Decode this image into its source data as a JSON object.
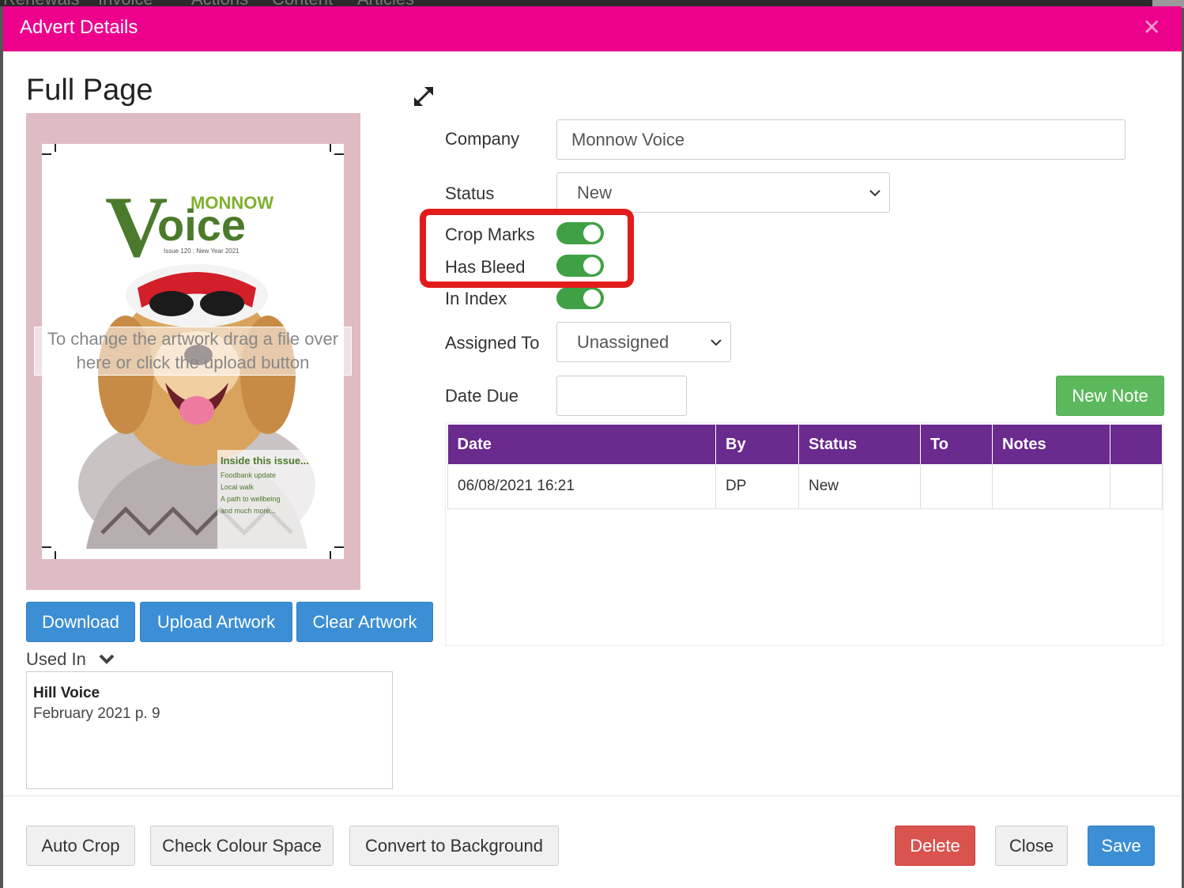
{
  "background": {
    "nav_items": [
      "Renewals",
      "Invoice",
      "Actions",
      "Content",
      "Articles"
    ]
  },
  "modal": {
    "title": "Advert Details",
    "close_icon": "close-icon",
    "heading": "Full Page",
    "expand_icon": "expand-arrows-icon"
  },
  "artwork": {
    "drop_hint": "To change the artwork drag a file over here or click the upload button",
    "cover": {
      "masthead_small": "MONNOW",
      "masthead_big_v": "V",
      "masthead_big": "oice",
      "issue": "Issue 120 : New Year 2021",
      "inside_title": "Inside this issue...",
      "inside_items": [
        "Foodbank update",
        "Local walk",
        "A path to wellbeing",
        "and much more..."
      ]
    },
    "buttons": {
      "download": "Download",
      "upload": "Upload Artwork",
      "clear": "Clear Artwork"
    }
  },
  "used_in": {
    "label": "Used In",
    "chevron_icon": "chevron-down-icon",
    "items": [
      {
        "title": "Hill Voice",
        "detail": "February 2021 p. 9"
      }
    ]
  },
  "form": {
    "company_label": "Company",
    "company_value": "Monnow Voice",
    "status_label": "Status",
    "status_value": "New",
    "crop_marks_label": "Crop Marks",
    "has_bleed_label": "Has Bleed",
    "in_index_label": "In Index",
    "assigned_label": "Assigned To",
    "assigned_value": "Unassigned",
    "date_due_label": "Date Due",
    "date_due_value": "",
    "toggles": {
      "crop_marks": true,
      "has_bleed": true,
      "in_index": true
    },
    "toggle_color": "#3fa045",
    "highlight_color": "#e31b1b"
  },
  "notes": {
    "new_note_button": "New Note",
    "columns": [
      "Date",
      "By",
      "Status",
      "To",
      "Notes",
      ""
    ],
    "rows": [
      [
        "06/08/2021 16:21",
        "DP",
        "New",
        "",
        "",
        ""
      ]
    ],
    "header_color": "#6a2a8e"
  },
  "footer": {
    "auto_crop": "Auto Crop",
    "check_colour": "Check Colour Space",
    "convert_bg": "Convert to Background",
    "delete": "Delete",
    "close": "Close",
    "save": "Save"
  },
  "colors": {
    "header": "#ec008c",
    "primary": "#3c8fd4",
    "success": "#5cb85c",
    "danger": "#d9534f"
  }
}
